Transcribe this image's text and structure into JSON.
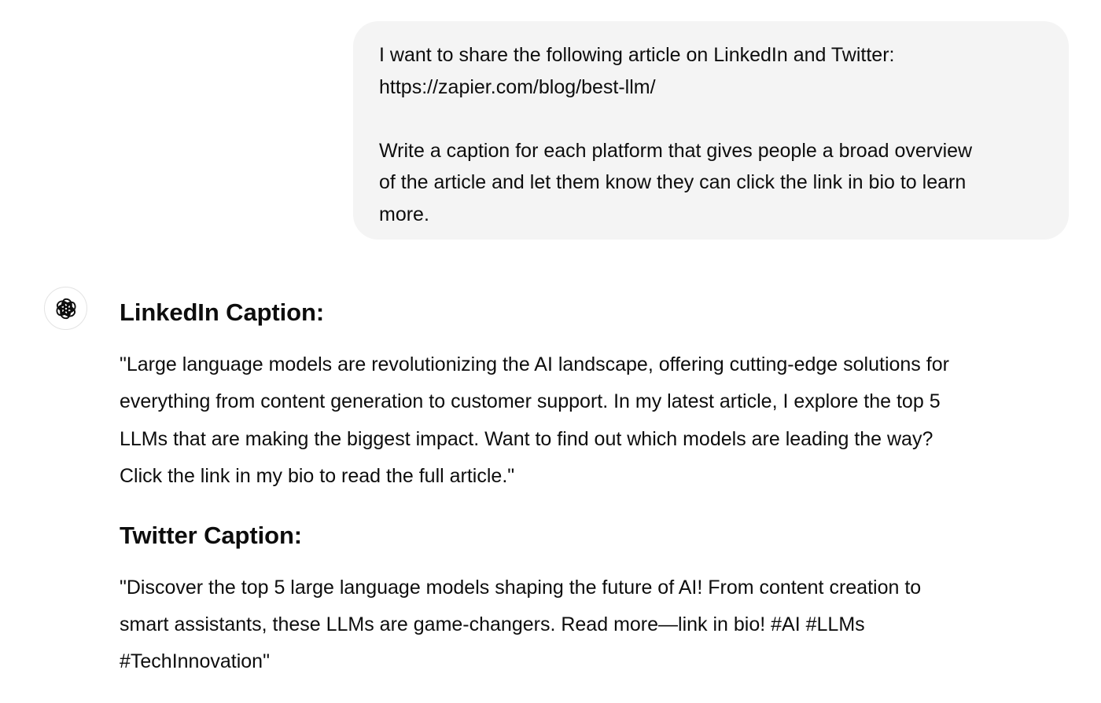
{
  "user_message": {
    "line1": "I want to share the following article on LinkedIn and Twitter:",
    "line2": "https://zapier.com/blog/best-llm/",
    "line3": "Write a caption for each platform that gives people a broad overview",
    "line4": "of the article and let them know they can click the link in bio to learn",
    "line5": "more."
  },
  "assistant": {
    "avatar_icon": "openai-logo-icon",
    "sections": [
      {
        "heading": "LinkedIn Caption:",
        "lines": [
          "\"Large language models are revolutionizing the AI landscape, offering cutting-edge solutions for",
          "everything from content generation to customer support. In my latest article, I explore the top 5",
          "LLMs that are making the biggest impact. Want to find out which models are leading the way?",
          "Click the link in my bio to read the full article.\""
        ]
      },
      {
        "heading": "Twitter Caption:",
        "lines": [
          "\"Discover the top 5 large language models shaping the future of AI! From content creation to",
          "smart assistants, these LLMs are game-changers. Read more—link in bio! #AI #LLMs",
          "#TechInnovation\""
        ]
      }
    ]
  }
}
